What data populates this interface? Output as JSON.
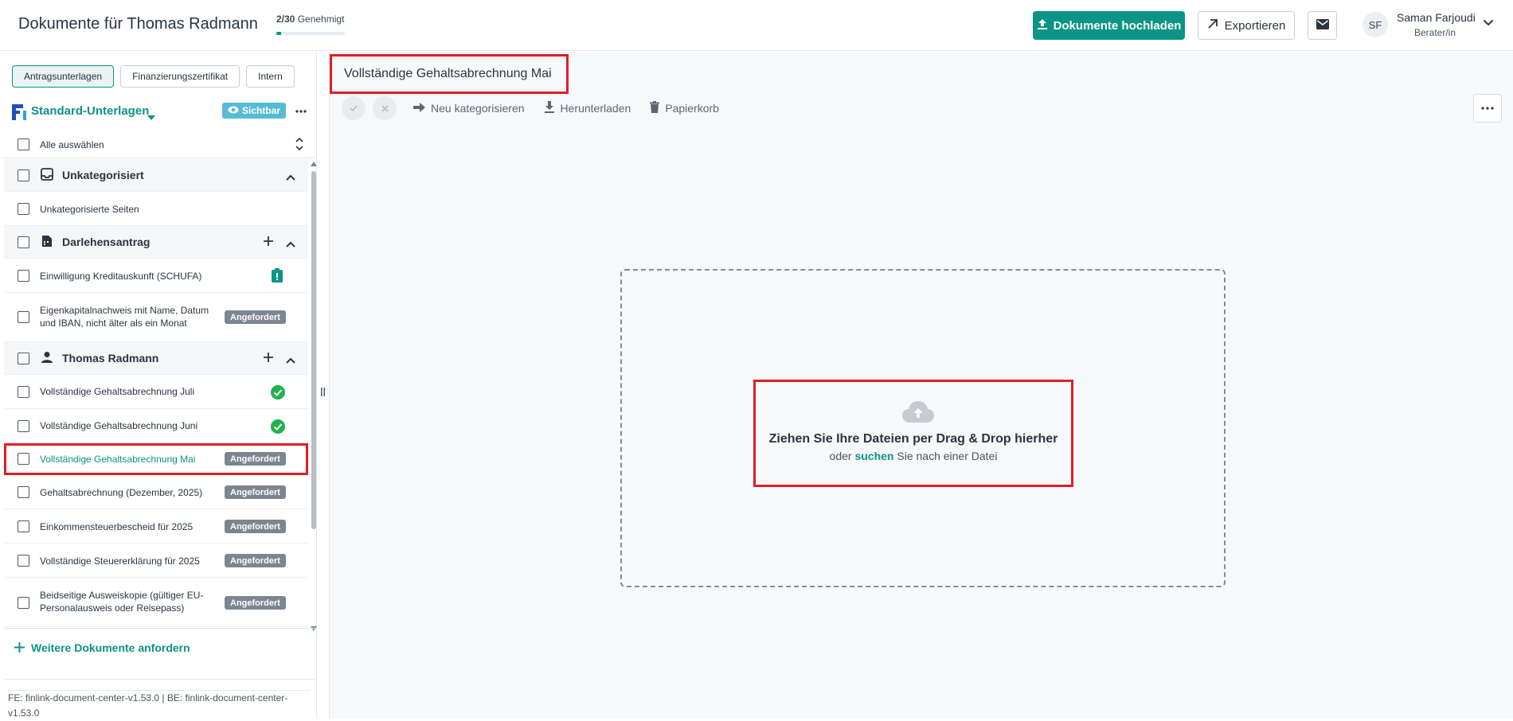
{
  "header": {
    "title": "Dokumente für Thomas Radmann",
    "progress_count": "2/30",
    "progress_label": "Genehmigt",
    "progress_value": 0.067,
    "upload_label": "Dokumente hochladen",
    "export_label": "Exportieren",
    "user_initials": "SF",
    "user_name": "Saman Farjoudi",
    "user_role": "Berater/in"
  },
  "sidebar": {
    "tabs": [
      {
        "label": "Antragsunterlagen",
        "active": true
      },
      {
        "label": "Finanzierungszertifikat",
        "active": false
      },
      {
        "label": "Intern",
        "active": false
      }
    ],
    "standard_label": "Standard-Unterlagen",
    "visible_badge": "Sichtbar",
    "select_all_label": "Alle auswählen",
    "groups": [
      {
        "label": "Unkategorisiert",
        "icon": "inbox-icon",
        "items": [
          {
            "label": "Unkategorisierte Seiten"
          }
        ]
      },
      {
        "label": "Darlehensantrag",
        "icon": "building-document-icon",
        "items": [
          {
            "label": "Einwilligung Kreditauskunft (SCHUFA)",
            "status": "clipboard-alert-icon"
          },
          {
            "label": "Eigenkapitalnachweis mit Name, Datum und IBAN, nicht älter als ein Monat",
            "status_tag": "Angefordert"
          }
        ]
      },
      {
        "label": "Thomas Radmann",
        "icon": "person-icon",
        "items": [
          {
            "label": "Vollständige Gehaltsabrechnung Juli",
            "status": "check-circle-icon"
          },
          {
            "label": "Vollständige Gehaltsabrechnung Juni",
            "status": "check-circle-icon"
          },
          {
            "label": "Vollständige Gehaltsabrechnung Mai",
            "status_tag": "Angefordert",
            "selected": true
          },
          {
            "label": "Gehaltsabrechnung (Dezember, 2025)",
            "status_tag": "Angefordert"
          },
          {
            "label": "Einkommensteuerbescheid für 2025",
            "status_tag": "Angefordert"
          },
          {
            "label": "Vollständige Steuererklärung für 2025",
            "status_tag": "Angefordert"
          },
          {
            "label": "Beidseitige Ausweiskopie (gültiger EU-Personalausweis oder Reisepass)",
            "status_tag": "Angefordert"
          }
        ]
      }
    ],
    "request_more_label": "Weitere Dokumente anfordern",
    "version_info": "FE: finlink-document-center-v1.53.0 | BE: finlink-document-center-v1.53.0"
  },
  "main": {
    "doc_title": "Vollständige Gehaltsabrechnung Mai",
    "toolbar": {
      "recategorize_label": "Neu kategorisieren",
      "download_label": "Herunterladen",
      "trash_label": "Papierkorb"
    },
    "dropzone": {
      "title": "Ziehen Sie Ihre Dateien per Drag & Drop hierher",
      "prefix": "oder",
      "link": "suchen",
      "suffix": "Sie nach einer Datei"
    }
  },
  "colors": {
    "accent": "#0c9486",
    "highlight": "#e01e24",
    "tag_gray": "#7b8691",
    "badge_blue": "#56bcd4",
    "success": "#22b24c"
  }
}
